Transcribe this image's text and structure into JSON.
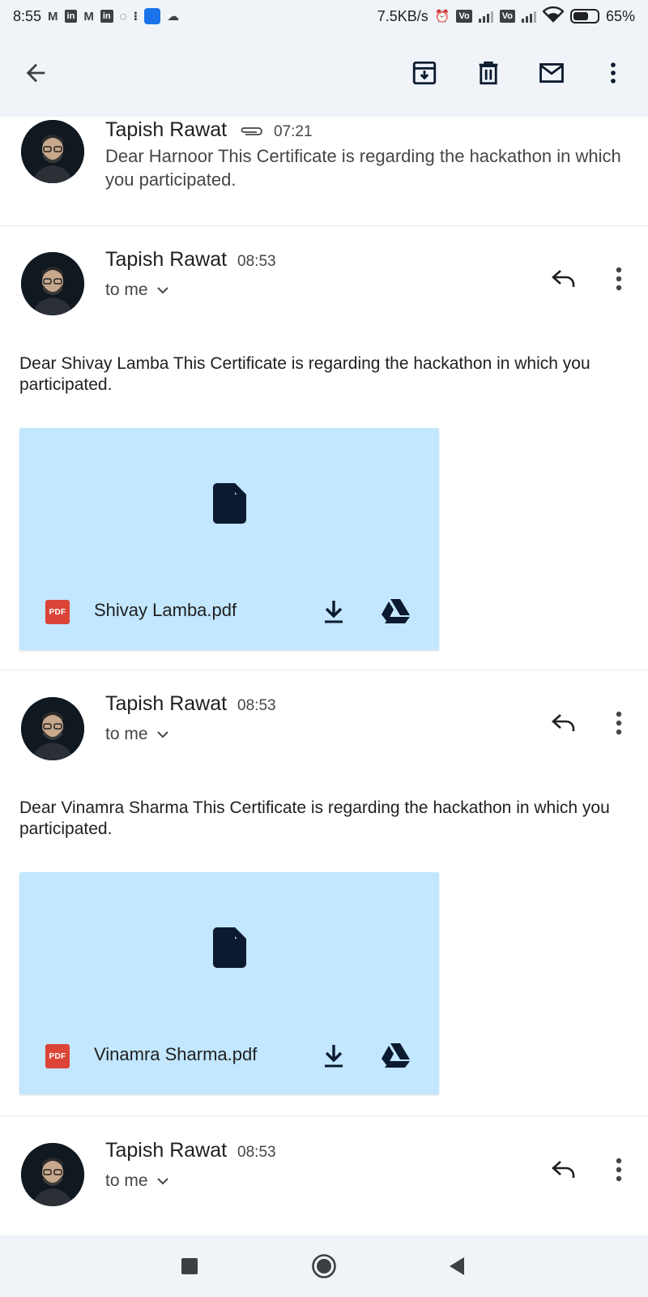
{
  "status_bar": {
    "time": "8:55",
    "network_speed": "7.5KB/s",
    "battery": "65%",
    "battery_level": 0.65,
    "icons": [
      "gmail-icon",
      "linkedin-icon",
      "gmail-icon",
      "linkedin-icon",
      "whatsapp-icon",
      "steps-icon",
      "app-icon",
      "cloud-icon",
      "alarm-icon",
      "volte-icon",
      "signal-icon",
      "volte-icon",
      "signal-icon",
      "wifi-icon",
      "battery-icon"
    ]
  },
  "toolbar": {
    "icons": [
      "back-icon",
      "archive-icon",
      "delete-icon",
      "mark-unread-icon",
      "more-vert-icon"
    ]
  },
  "messages": [
    {
      "sender": "Tapish Rawat",
      "time": "07:21",
      "has_attachment_icon": true,
      "snippet": "Dear Harnoor This Certificate is regarding the hackathon in which you participated."
    },
    {
      "sender": "Tapish Rawat",
      "time": "08:53",
      "recipient": "to me",
      "body": "Dear Shivay Lamba This Certificate is regarding the hackathon in which you participated.",
      "attachment": {
        "badge": "PDF",
        "name": "Shivay Lamba.pdf"
      }
    },
    {
      "sender": "Tapish Rawat",
      "time": "08:53",
      "recipient": "to me",
      "body": "Dear Vinamra Sharma This Certificate is regarding the hackathon in which you participated.",
      "attachment": {
        "badge": "PDF",
        "name": "Vinamra Sharma.pdf"
      }
    },
    {
      "sender": "Tapish Rawat",
      "time": "08:53",
      "recipient": "to me"
    }
  ],
  "colors": {
    "header_bg": "#f0f4f9",
    "attachment_bg": "#c2e7ff",
    "pdf_red": "#db4437",
    "icon_dark": "#0b1a2e"
  }
}
